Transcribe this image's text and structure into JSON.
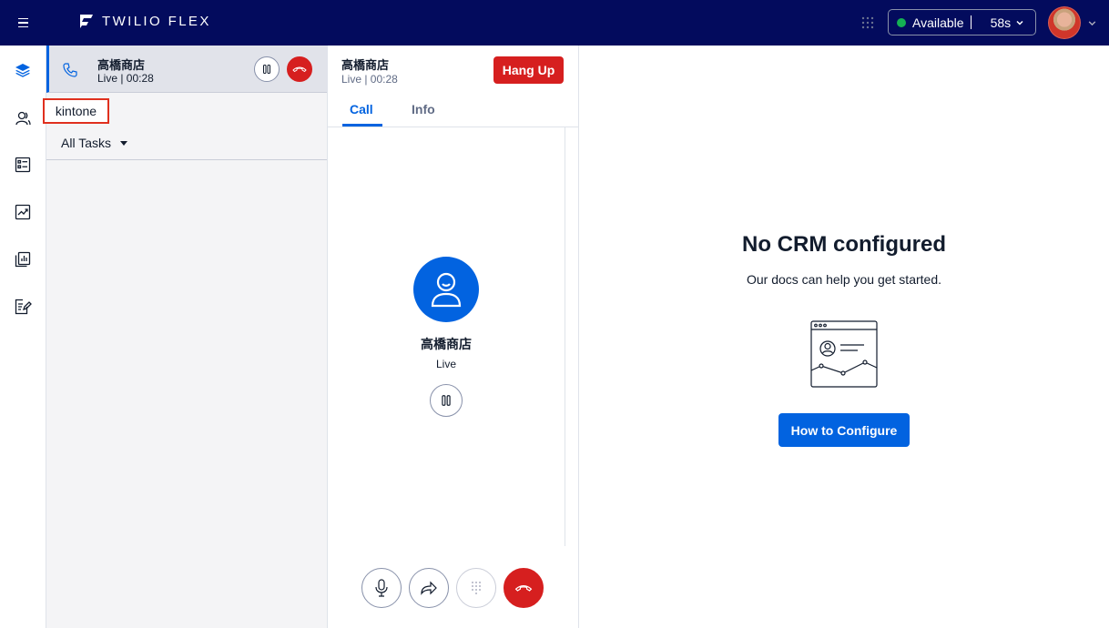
{
  "app": {
    "brand": "TWILIO FLEX"
  },
  "status": {
    "label": "Available",
    "timer": "58s",
    "color": "#14b053"
  },
  "colors": {
    "topbar": "#030b5d",
    "accent": "#0263e0",
    "danger": "#d61f1f"
  },
  "sidenav": {
    "items": [
      {
        "icon": "layers-icon",
        "name": "agent-desktop"
      },
      {
        "icon": "contacts-icon",
        "name": "teams"
      },
      {
        "icon": "queues-icon",
        "name": "queues-stats"
      },
      {
        "icon": "analytics-icon",
        "name": "insights"
      },
      {
        "icon": "reports-icon",
        "name": "reports"
      },
      {
        "icon": "edit-icon",
        "name": "quality"
      }
    ]
  },
  "task": {
    "name": "高橋商店",
    "sub": "Live | 00:28"
  },
  "kintone_label": "kintone",
  "filter": {
    "label": "All Tasks"
  },
  "call": {
    "name": "高橋商店",
    "sub": "Live | 00:28",
    "hangup_label": "Hang Up",
    "tabs": [
      "Call",
      "Info"
    ],
    "active_tab": "Call",
    "center_name": "高橋商店",
    "center_status": "Live"
  },
  "crm": {
    "title": "No CRM configured",
    "subtitle": "Our docs can help you get started.",
    "button_label": "How to Configure"
  }
}
